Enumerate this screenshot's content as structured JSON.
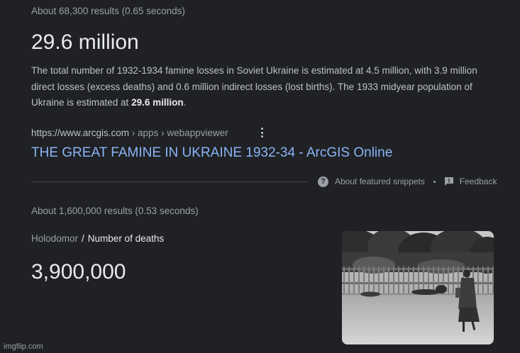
{
  "first_result": {
    "stats": "About 68,300 results (0.65 seconds)",
    "answer": "29.6 million",
    "snippet_text": "The total number of 1932-1934 famine losses in Soviet Ukraine is estimated at 4.5 million, with 3.9 million direct losses (excess deaths) and 0.6 million indirect losses (lost births). The 1933 midyear population of Ukraine is estimated at ",
    "snippet_bold": "29.6 million",
    "snippet_end": ".",
    "source_domain": "https://www.arcgis.com",
    "source_path": " › apps › webappviewer",
    "link_title": "THE GREAT FAMINE IN UKRAINE 1932-34 - ArcGIS Online",
    "about_snippets": "About featured snippets",
    "feedback": "Feedback"
  },
  "second_result": {
    "stats": "About 1,600,000 results (0.53 seconds)",
    "breadcrumb_parent": "Holodomor",
    "breadcrumb_separator": "/",
    "breadcrumb_current": "Number of deaths",
    "answer": "3,900,000"
  },
  "icons": {
    "menu": "vertical-dots-icon",
    "help": "question-circle-icon",
    "feedback": "feedback-flag-icon"
  },
  "watermark": "imgflip.com"
}
